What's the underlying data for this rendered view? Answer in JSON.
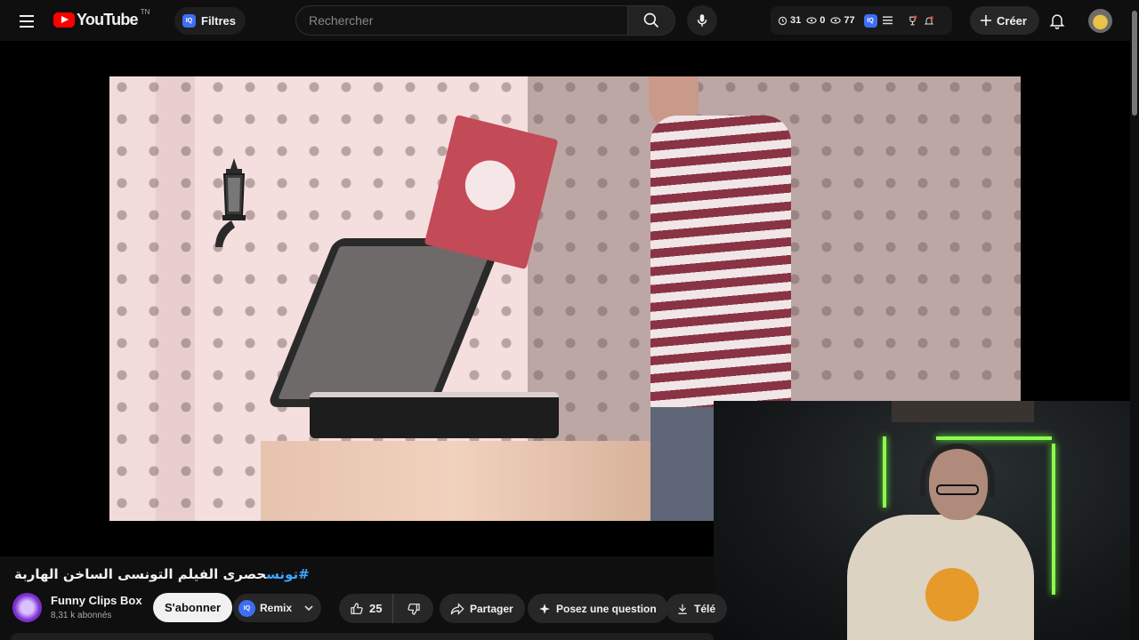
{
  "header": {
    "logo_text": "YouTube",
    "logo_country": "TN",
    "filters_label": "Filtres",
    "filters_badge": "IQ",
    "search_placeholder": "Rechercher",
    "stats": {
      "watch_count": "31",
      "views_zero": "0",
      "views_total": "77"
    },
    "stats_badge": "IQ",
    "create_label": "Créer"
  },
  "video": {
    "title_hashtag": "#تونس",
    "title_text": "حصرى الفيلم التونسى الساخن الهاربة"
  },
  "channel": {
    "name": "Funny Clips Box",
    "subscribers": "8,31 k abonnés",
    "subscribe_label": "S'abonner"
  },
  "actions": {
    "remix_label": "Remix",
    "remix_badge": "IQ",
    "like_count": "25",
    "share_label": "Partager",
    "ask_label": "Posez une question",
    "download_label": "Télé"
  },
  "colors": {
    "accent_red": "#ff0000",
    "link_blue": "#3ea6ff",
    "iq_blue": "#3d6ef5",
    "background": "#0f0f0f"
  }
}
